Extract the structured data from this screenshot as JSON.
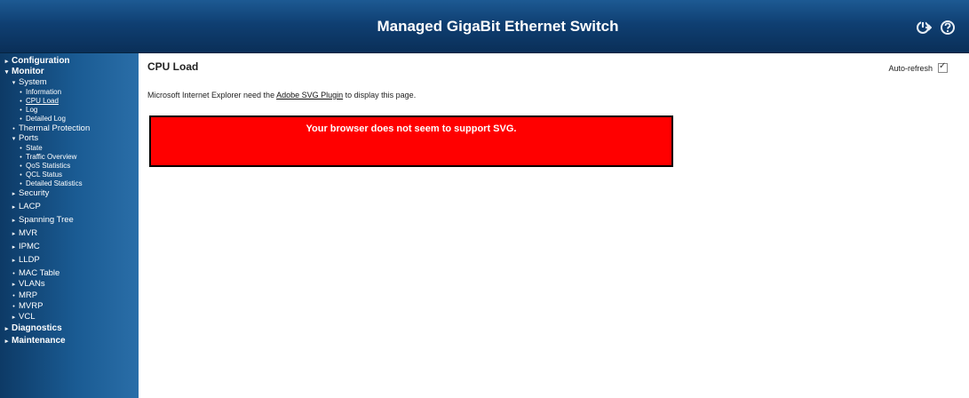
{
  "header": {
    "title": "Managed GigaBit Ethernet Switch"
  },
  "nav": [
    {
      "label": "Configuration",
      "mark": "▸"
    },
    {
      "label": "Monitor",
      "mark": "▾"
    },
    {
      "label": "System",
      "mark": "▾"
    },
    {
      "label": "Information",
      "mark": "•"
    },
    {
      "label": "CPU Load",
      "mark": "•"
    },
    {
      "label": "Log",
      "mark": "•"
    },
    {
      "label": "Detailed Log",
      "mark": "•"
    },
    {
      "label": "Thermal Protection",
      "mark": "•"
    },
    {
      "label": "Ports",
      "mark": "▾"
    },
    {
      "label": "State",
      "mark": "•"
    },
    {
      "label": "Traffic Overview",
      "mark": "•"
    },
    {
      "label": "QoS Statistics",
      "mark": "•"
    },
    {
      "label": "QCL Status",
      "mark": "•"
    },
    {
      "label": "Detailed Statistics",
      "mark": "•"
    },
    {
      "label": "Security",
      "mark": "▸"
    },
    {
      "label": "LACP",
      "mark": "▸"
    },
    {
      "label": "Spanning Tree",
      "mark": "▸"
    },
    {
      "label": "MVR",
      "mark": "▸"
    },
    {
      "label": "IPMC",
      "mark": "▸"
    },
    {
      "label": "LLDP",
      "mark": "▸"
    },
    {
      "label": "MAC Table",
      "mark": "•"
    },
    {
      "label": "VLANs",
      "mark": "▸"
    },
    {
      "label": "MRP",
      "mark": "•"
    },
    {
      "label": "MVRP",
      "mark": "•"
    },
    {
      "label": "VCL",
      "mark": "▸"
    },
    {
      "label": "Diagnostics",
      "mark": "▸"
    },
    {
      "label": "Maintenance",
      "mark": "▸"
    }
  ],
  "main": {
    "title": "CPU Load",
    "auto_refresh_label": "Auto-refresh",
    "notice_prefix": "Microsoft Internet Explorer need the ",
    "notice_link": "Adobe SVG Plugin",
    "notice_suffix": " to display this page.",
    "svg_message": "Your browser does not seem to support SVG."
  }
}
